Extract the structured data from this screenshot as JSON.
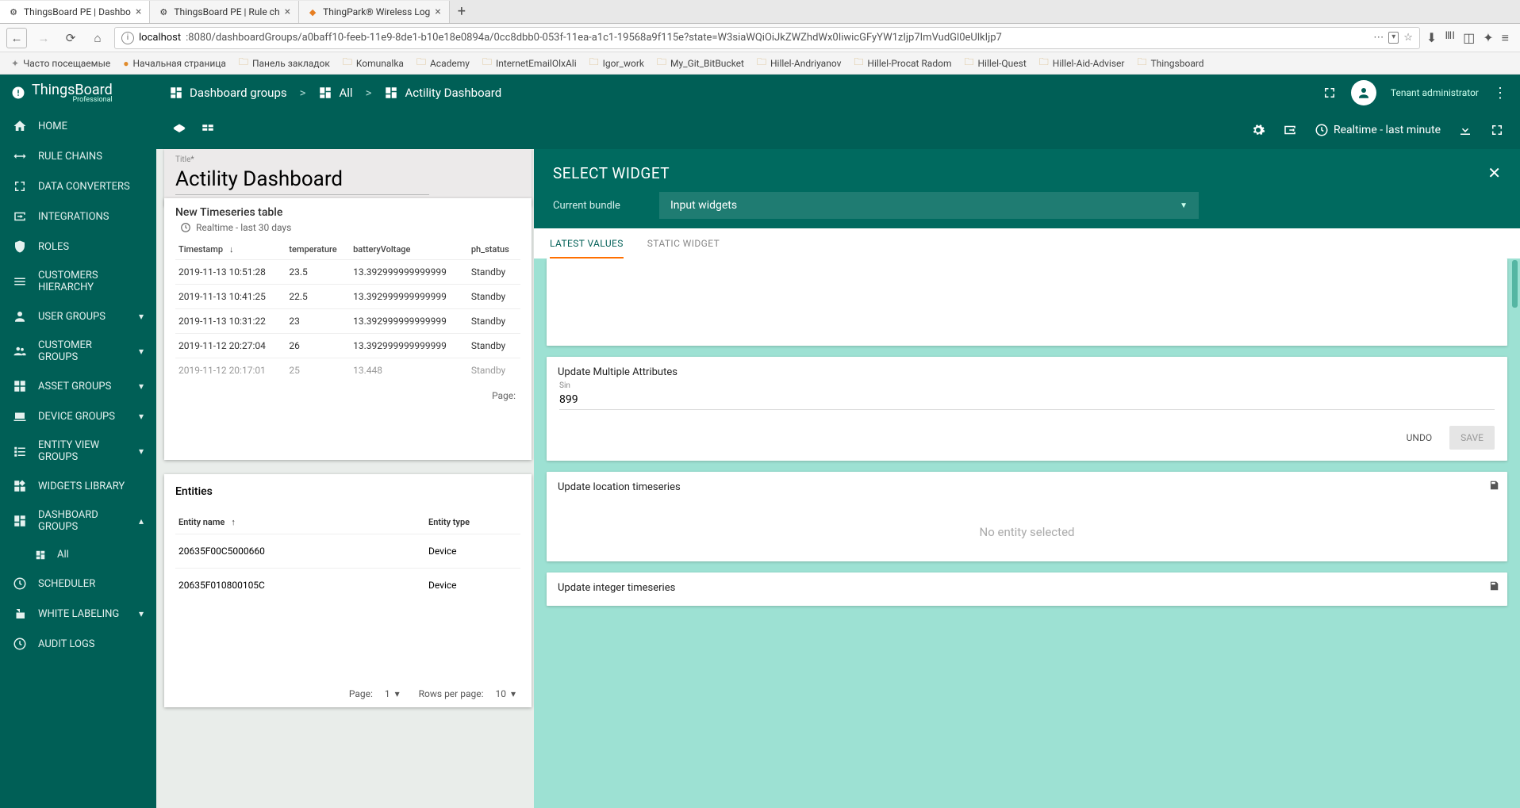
{
  "browser": {
    "tabs": [
      {
        "title": "ThingsBoard PE | Dashbo",
        "icon": "⚙"
      },
      {
        "title": "ThingsBoard PE | Rule ch",
        "icon": "⚙"
      },
      {
        "title": "ThingPark® Wireless Log",
        "icon": "◆"
      }
    ],
    "url_host": "localhost",
    "url_path": ":8080/dashboardGroups/a0baff10-feeb-11e9-8de1-b10e18e0894a/0cc8dbb0-053f-11ea-a1c1-19568a9f115e?state=W3siaWQiOiJkZWZhdWx0IiwicGFyYW1zIjp7ImVudGl0eUlkIjp7",
    "bookmarks": [
      {
        "label": "Часто посещаемые",
        "type": "sys"
      },
      {
        "label": "Начальная страница",
        "type": "ff"
      },
      {
        "label": "Панель закладок",
        "type": "folder"
      },
      {
        "label": "Komunalka",
        "type": "folder"
      },
      {
        "label": "Academy",
        "type": "folder"
      },
      {
        "label": "InternetEmailOlxAli",
        "type": "folder"
      },
      {
        "label": "Igor_work",
        "type": "folder"
      },
      {
        "label": "My_Git_BitBucket",
        "type": "folder"
      },
      {
        "label": "Hillel-Andriyanov",
        "type": "folder"
      },
      {
        "label": "Hillel-Procat Radom",
        "type": "folder"
      },
      {
        "label": "Hillel-Quest",
        "type": "folder"
      },
      {
        "label": "Hillel-Aid-Adviser",
        "type": "folder"
      },
      {
        "label": "Thingsboard",
        "type": "folder"
      }
    ]
  },
  "brand": {
    "name": "ThingsBoard",
    "sub": "Professional"
  },
  "topbar": {
    "crumb1": "Dashboard groups",
    "crumb2": "All",
    "crumb3": "Actility Dashboard",
    "username": "Tenant administrator"
  },
  "toolbar": {
    "realtime": "Realtime - last minute"
  },
  "sidebar": [
    {
      "icon": "home",
      "label": "HOME"
    },
    {
      "icon": "swap",
      "label": "RULE CHAINS"
    },
    {
      "icon": "transform",
      "label": "DATA CONVERTERS"
    },
    {
      "icon": "input",
      "label": "INTEGRATIONS"
    },
    {
      "icon": "shield",
      "label": "ROLES"
    },
    {
      "icon": "hierarchy",
      "label": "CUSTOMERS HIERARCHY"
    },
    {
      "icon": "user",
      "label": "USER GROUPS",
      "exp": true
    },
    {
      "icon": "users",
      "label": "CUSTOMER GROUPS",
      "exp": true
    },
    {
      "icon": "domain",
      "label": "ASSET GROUPS",
      "exp": true
    },
    {
      "icon": "device",
      "label": "DEVICE GROUPS",
      "exp": true
    },
    {
      "icon": "view",
      "label": "ENTITY VIEW GROUPS",
      "exp": true
    },
    {
      "icon": "widgets",
      "label": "WIDGETS LIBRARY"
    },
    {
      "icon": "dash",
      "label": "DASHBOARD GROUPS",
      "exp": true,
      "open": true,
      "children": [
        {
          "icon": "dash",
          "label": "All"
        }
      ]
    },
    {
      "icon": "clock",
      "label": "SCHEDULER"
    },
    {
      "icon": "label",
      "label": "WHITE LABELING",
      "exp": true
    },
    {
      "icon": "audit",
      "label": "AUDIT LOGS"
    }
  ],
  "title_card": {
    "label": "Title",
    "req": "*",
    "value": "Actility Dashboard"
  },
  "ts_widget": {
    "title": "New Timeseries table",
    "realtime": "Realtime - last 30 days",
    "columns": [
      "Timestamp",
      "temperature",
      "batteryVoltage",
      "ph_status"
    ],
    "rows": [
      [
        "2019-11-13 10:51:28",
        "23.5",
        "13.392999999999999",
        "Standby"
      ],
      [
        "2019-11-13 10:41:25",
        "22.5",
        "13.392999999999999",
        "Standby"
      ],
      [
        "2019-11-13 10:31:22",
        "23",
        "13.392999999999999",
        "Standby"
      ],
      [
        "2019-11-12 20:27:04",
        "26",
        "13.392999999999999",
        "Standby"
      ],
      [
        "2019-11-12 20:17:01",
        "25",
        "13.448",
        "Standby"
      ]
    ],
    "pager": "Page:"
  },
  "entities": {
    "title": "Entities",
    "columns": [
      "Entity name",
      "Entity type"
    ],
    "rows": [
      [
        "20635F00C5000660",
        "Device"
      ],
      [
        "20635F010800105C",
        "Device"
      ]
    ],
    "foot": {
      "page_lbl": "Page:",
      "page_val": "1",
      "rows_lbl": "Rows per page:",
      "rows_val": "10"
    }
  },
  "select_widget": {
    "heading": "SELECT WIDGET",
    "bundle_lbl": "Current bundle",
    "bundle_val": "Input widgets",
    "tabs": [
      "LATEST VALUES",
      "STATIC WIDGET"
    ],
    "w1": {
      "title": "Update Multiple Attributes",
      "field_label": "Sin",
      "field_value": "899",
      "undo": "UNDO",
      "save": "SAVE"
    },
    "w2": {
      "title": "Update location timeseries",
      "empty": "No entity selected"
    },
    "w3": {
      "title": "Update integer timeseries"
    }
  }
}
